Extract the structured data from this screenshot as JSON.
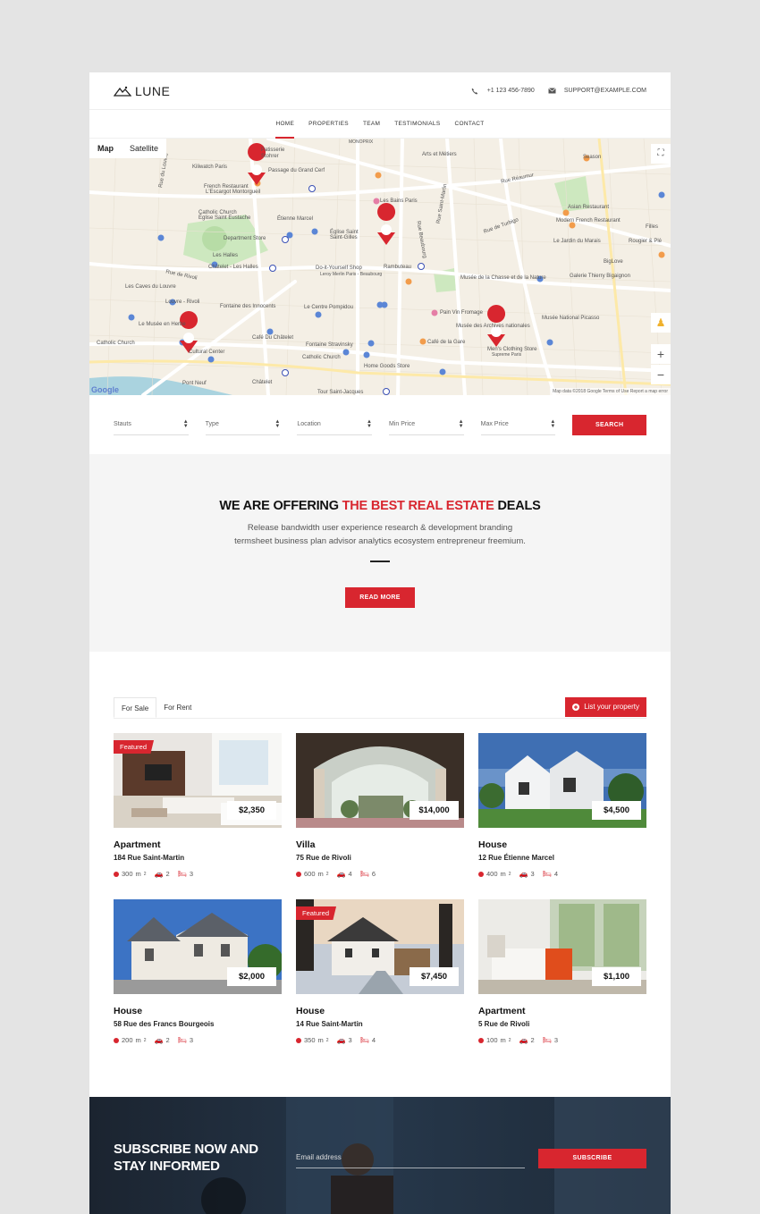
{
  "header": {
    "logo_text": "LUNE",
    "phone": "+1 123 456-7890",
    "email": "SUPPORT@EXAMPLE.COM"
  },
  "nav": {
    "items": [
      {
        "label": "HOME",
        "active": true
      },
      {
        "label": "PROPERTIES",
        "active": false
      },
      {
        "label": "TEAM",
        "active": false
      },
      {
        "label": "TESTIMONIALS",
        "active": false
      },
      {
        "label": "CONTACT",
        "active": false
      }
    ]
  },
  "map": {
    "type_map": "Map",
    "type_satellite": "Satellite",
    "zoom_in": "+",
    "zoom_out": "−",
    "footer": "Map data ©2018 Google   Terms of Use   Report a map error",
    "google": "Google",
    "labels": [
      "Patisserie",
      "Stohrer",
      "Kiliwatch Paris",
      "Passage du Grand Cerf",
      "French Restaurant",
      "L'Escargot Montorgueil",
      "Catholic Church",
      "Église Saint Eustache",
      "Étienne Marcel",
      "Department Store",
      "Les Halles",
      "Église Saint",
      "Saint-Gilles",
      "Châtelet - Les Halles",
      "Les Caves du Louvre",
      "Louvre - Rivoli",
      "Fontaine des Innocents",
      "Le Centre Pompidou",
      "Do-it-Yourself Shop",
      "Leroy Merlin Paris - Beaubourg",
      "Rambuteau",
      "Musée de la Chasse et de la Nature",
      "Le Musée en Herbe",
      "Catholic Church",
      "Cultural Center",
      "Café Du Châtelet",
      "Fontaine Stravinsky",
      "Catholic Church",
      "Pain Vin Fromage",
      "Musée des Archives nationales",
      "Café de la Gare",
      "Men's Clothing Store",
      "Supreme Paris",
      "Home Goods Store",
      "Pont Neuf",
      "Tour Saint-Jacques",
      "Châtelet",
      "Arts et Métiers",
      "Les Bains Paris",
      "Season",
      "Asian Restaurant",
      "Modern French Restaurant",
      "Le Jardin du Marais",
      "Galerie Thierry Bigaignon",
      "Musée National Picasso",
      "BigLove",
      "Rougier & Plé",
      "Filles",
      "Rue du Louvre",
      "Rue Réaumur",
      "Rue Beaubourg",
      "Rue de Rivoli",
      "MONOPRIX",
      "Rue Saint-Martin",
      "Rue de Turbigo"
    ]
  },
  "search": {
    "fields": [
      "Stauts",
      "Type",
      "Location",
      "Min Price",
      "Max Price"
    ],
    "button": "SEARCH"
  },
  "intro": {
    "title_part1": "WE ARE OFFERING ",
    "title_highlight": "THE BEST REAL ESTATE",
    "title_part2": " DEALS",
    "line1": "Release bandwidth user experience research & development branding",
    "line2": "termsheet business plan advisor analytics ecosystem entrepreneur freemium.",
    "button": "READ MORE"
  },
  "listings": {
    "tabs": [
      "For Sale",
      "For Rent"
    ],
    "list_button": "List your property",
    "area_unit": "m",
    "properties": [
      {
        "type": "Apartment",
        "address": "184 Rue Saint-Martin",
        "price": "$2,350",
        "area": "300",
        "cars": "2",
        "beds": "3",
        "featured": "Featured"
      },
      {
        "type": "Villa",
        "address": "75 Rue de Rivoli",
        "price": "$14,000",
        "area": "600",
        "cars": "4",
        "beds": "6",
        "featured": ""
      },
      {
        "type": "House",
        "address": "12 Rue Étienne Marcel",
        "price": "$4,500",
        "area": "400",
        "cars": "3",
        "beds": "4",
        "featured": ""
      },
      {
        "type": "House",
        "address": "58 Rue des Francs Bourgeois",
        "price": "$2,000",
        "area": "200",
        "cars": "2",
        "beds": "3",
        "featured": ""
      },
      {
        "type": "House",
        "address": "14 Rue Saint-Martin",
        "price": "$7,450",
        "area": "350",
        "cars": "3",
        "beds": "4",
        "featured": "Featured"
      },
      {
        "type": "Apartment",
        "address": "5 Rue de Rivoli",
        "price": "$1,100",
        "area": "100",
        "cars": "2",
        "beds": "3",
        "featured": ""
      }
    ]
  },
  "subscribe": {
    "title_line1": "SUBSCRIBE NOW AND",
    "title_line2": "STAY INFORMED",
    "email_placeholder": "Email address",
    "button": "SUBSCRIBE"
  },
  "colors": {
    "accent": "#d8262f",
    "intro_bg": "#f5f5f5",
    "page_bg": "#e4e4e4"
  }
}
